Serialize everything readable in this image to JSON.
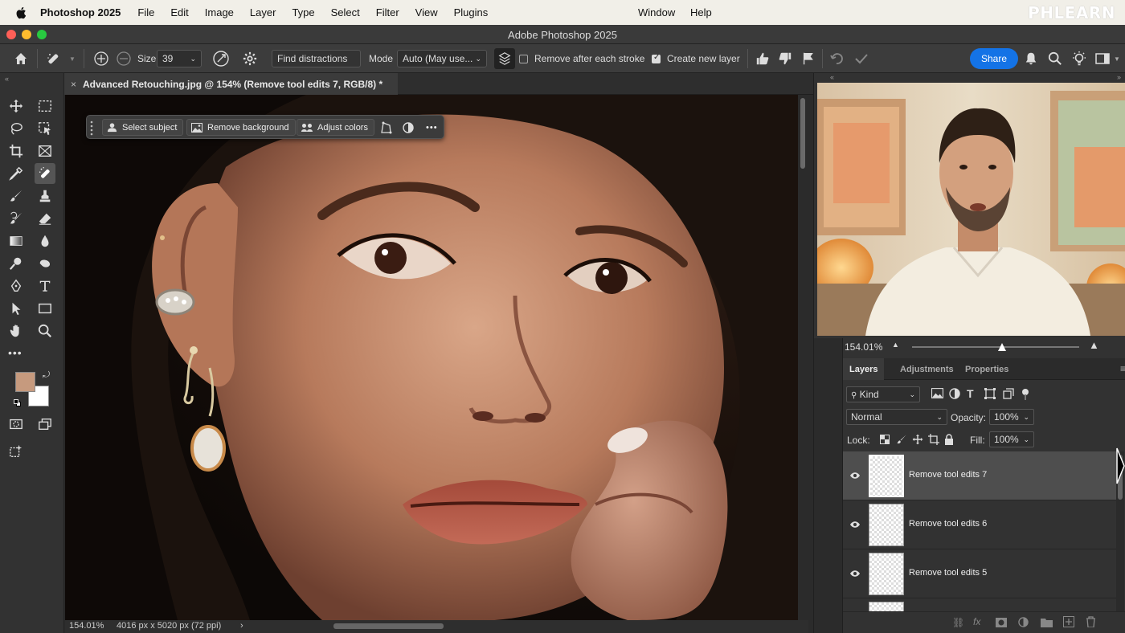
{
  "menubar": {
    "app_name": "Photoshop 2025",
    "items": [
      "File",
      "Edit",
      "Image",
      "Layer",
      "Type",
      "Select",
      "Filter",
      "View",
      "Plugins"
    ],
    "window": "Window",
    "help": "Help",
    "brand_logo": "PHLEARN"
  },
  "window": {
    "title": "Adobe Photoshop 2025"
  },
  "options_bar": {
    "size_label": "Size",
    "size_value": "39",
    "find_distractions": "Find distractions",
    "mode_label": "Mode",
    "mode_value": "Auto (May use...",
    "remove_after_stroke": "Remove after each stroke",
    "remove_after_stroke_checked": false,
    "create_new_layer": "Create new layer",
    "create_new_layer_checked": true,
    "share": "Share"
  },
  "document_tab": {
    "title": "Advanced Retouching.jpg @ 154% (Remove tool edits 7, RGB/8) *",
    "close": "×"
  },
  "context_bar": {
    "select_subject": "Select subject",
    "remove_background": "Remove background",
    "adjust_colors": "Adjust colors",
    "more": "•••"
  },
  "toolbar": {
    "foreground_color": "#c69a7e",
    "background_color": "#ffffff",
    "more_tools": "•••"
  },
  "status_bar": {
    "zoom": "154.01%",
    "doc_size": "4016 px x 5020 px (72 ppi)",
    "arrow": "›"
  },
  "navigator": {
    "zoom": "154.01%"
  },
  "panel_tabs": [
    {
      "label": "Layers",
      "active": true
    },
    {
      "label": "Adjustments",
      "active": false
    },
    {
      "label": "Properties",
      "active": false
    }
  ],
  "layers_panel": {
    "filter_kind": "Kind",
    "blend_mode": "Normal",
    "opacity_label": "Opacity:",
    "opacity_value": "100%",
    "lock_label": "Lock:",
    "fill_label": "Fill:",
    "fill_value": "100%",
    "layers": [
      {
        "name": "Remove tool edits 7",
        "selected": true
      },
      {
        "name": "Remove tool edits 6",
        "selected": false
      },
      {
        "name": "Remove tool edits 5",
        "selected": false
      },
      {
        "name": "",
        "selected": false
      }
    ]
  },
  "colors": {
    "accent": "#1473e6",
    "menubar_bg": "#f1efe8"
  }
}
